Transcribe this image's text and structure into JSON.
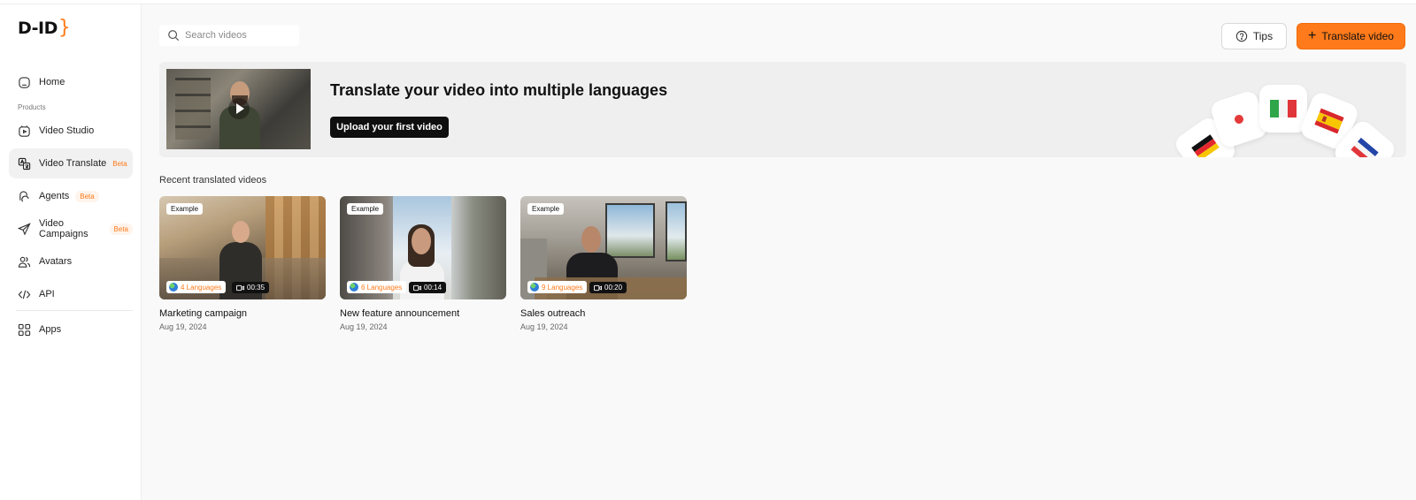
{
  "app": {
    "logo_text": "D-ID",
    "logo_bracket": "}"
  },
  "sidebar": {
    "home": "Home",
    "products_label": "Products",
    "items": [
      {
        "label": "Video Studio",
        "badge": ""
      },
      {
        "label": "Video Translate",
        "badge": "Beta"
      },
      {
        "label": "Agents",
        "badge": "Beta"
      },
      {
        "label": "Video Campaigns",
        "badge": "Beta"
      },
      {
        "label": "Avatars",
        "badge": ""
      },
      {
        "label": "API",
        "badge": ""
      }
    ],
    "apps": "Apps"
  },
  "search": {
    "placeholder": "Search videos"
  },
  "header": {
    "tips_label": "Tips",
    "translate_label": "Translate video"
  },
  "banner": {
    "title": "Translate your video into multiple languages",
    "upload_label": "Upload your first video"
  },
  "recent": {
    "title": "Recent translated videos",
    "videos": [
      {
        "tag": "Example",
        "languages": "4 Languages",
        "duration": "00:35",
        "title": "Marketing campaign",
        "date": "Aug 19, 2024"
      },
      {
        "tag": "Example",
        "languages": "6 Languages",
        "duration": "00:14",
        "title": "New feature announcement",
        "date": "Aug 19, 2024"
      },
      {
        "tag": "Example",
        "languages": "9 Languages",
        "duration": "00:20",
        "title": "Sales outreach",
        "date": "Aug 19, 2024"
      }
    ]
  },
  "colors": {
    "accent": "#ff7a1a",
    "upload_button": "#0f0f0f",
    "active_nav": "#f1f1f1"
  }
}
